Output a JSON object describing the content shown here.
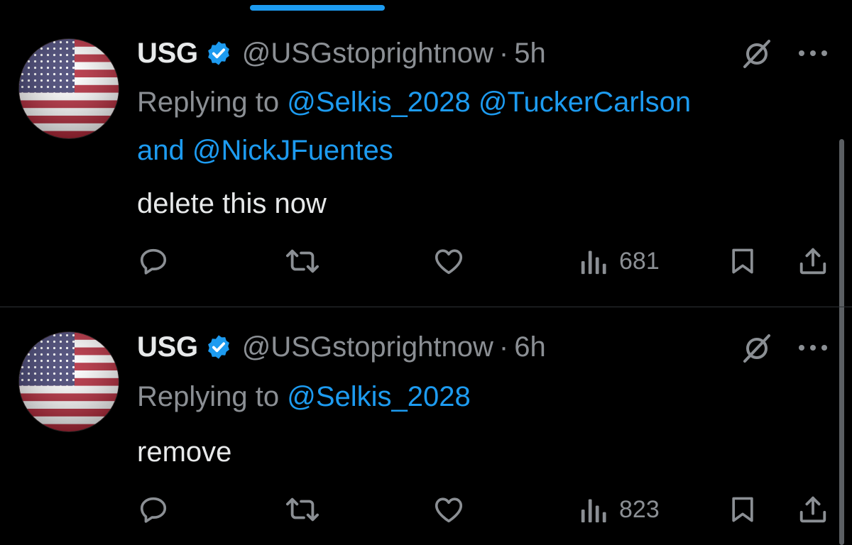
{
  "colors": {
    "background": "#000000",
    "text_primary": "#e7e9ea",
    "text_secondary": "#8b8f94",
    "accent": "#1d9bf0",
    "divider": "#2f3336"
  },
  "tweets": [
    {
      "display_name": "USG",
      "handle": "@USGstoprightnow",
      "separator": "·",
      "time": "5h",
      "replying_prefix": "Replying to",
      "mentions": [
        "@Selkis_2028",
        "@TuckerCarlson",
        "@NickJFuentes"
      ],
      "mention_joiner": "and",
      "text": "delete this now",
      "views": "681",
      "icons": [
        "verified-badge-icon",
        "grok-icon",
        "more-icon",
        "reply-icon",
        "repost-icon",
        "like-icon",
        "views-icon",
        "bookmark-icon",
        "share-icon"
      ]
    },
    {
      "display_name": "USG",
      "handle": "@USGstoprightnow",
      "separator": "·",
      "time": "6h",
      "replying_prefix": "Replying to",
      "mentions": [
        "@Selkis_2028"
      ],
      "text": "remove",
      "views": "823",
      "icons": [
        "verified-badge-icon",
        "grok-icon",
        "more-icon",
        "reply-icon",
        "repost-icon",
        "like-icon",
        "views-icon",
        "bookmark-icon",
        "share-icon"
      ]
    }
  ]
}
